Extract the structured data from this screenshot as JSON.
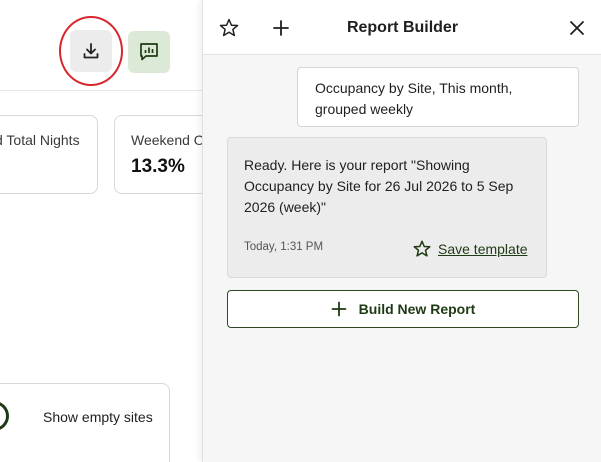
{
  "toolbar": {
    "download_icon": "download-icon",
    "report_icon": "chart-report-icon"
  },
  "stats": [
    {
      "label": "d Total Nights",
      "value": ""
    },
    {
      "label": "Weekend O",
      "value": "13.3%"
    }
  ],
  "filters": {
    "show_empty_sites_label": "Show empty sites",
    "show_empty_sites_on": true
  },
  "panel": {
    "title": "Report Builder",
    "user_message": "Occupancy by Site, This month, grouped weekly",
    "bot_message": "Ready. Here is your report \"Showing Occupancy by Site for 26 Jul 2026 to 5 Sep 2026 (week)\"",
    "bot_timestamp": "Today, 1:31 PM",
    "save_template_label": "Save template",
    "build_new_label": "Build New Report"
  },
  "colors": {
    "accent_dark_green": "#1e3a14",
    "report_button_bg": "#dbe9d6",
    "highlight_red": "#d8262c"
  }
}
